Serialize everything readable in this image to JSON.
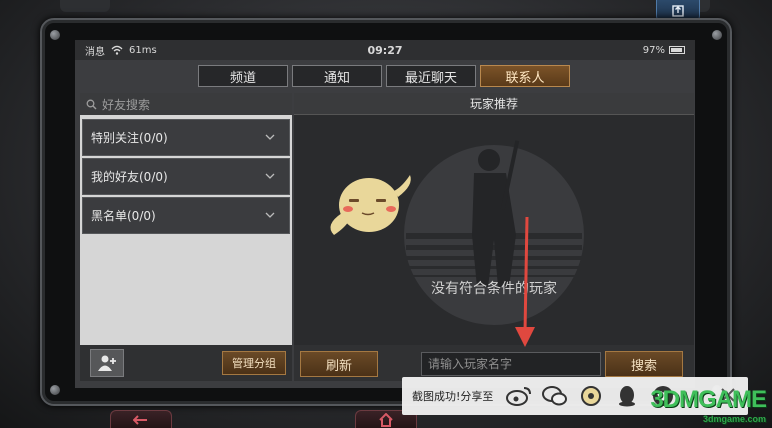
{
  "status_bar": {
    "carrier": "消息",
    "signal": "61ms",
    "time": "09:27",
    "battery": "97%"
  },
  "tabs": [
    {
      "label": "频道",
      "active": false
    },
    {
      "label": "通知",
      "active": false
    },
    {
      "label": "最近聊天",
      "active": false
    },
    {
      "label": "联系人",
      "active": true
    }
  ],
  "left_panel": {
    "search_placeholder": "好友搜索",
    "groups": [
      {
        "label": "特别关注(0/0)"
      },
      {
        "label": "我的好友(0/0)"
      },
      {
        "label": "黑名单(0/0)"
      }
    ],
    "manage_label": "管理分组"
  },
  "right_panel": {
    "title": "玩家推荐",
    "empty_text": "没有符合条件的玩家",
    "refresh_label": "刷新",
    "name_placeholder": "请输入玩家名字",
    "search_label": "搜索"
  },
  "share_bar": {
    "label": "截图成功!分享至",
    "icons": [
      "weibo-icon",
      "wechat-icon",
      "friends-circle-icon",
      "qq-icon",
      "favorite-icon"
    ]
  },
  "watermark": {
    "text": "3DMGAME",
    "sub": "3dmgame.com"
  },
  "colors": {
    "accent": "#7b5328",
    "annotation": "#e0483f"
  }
}
